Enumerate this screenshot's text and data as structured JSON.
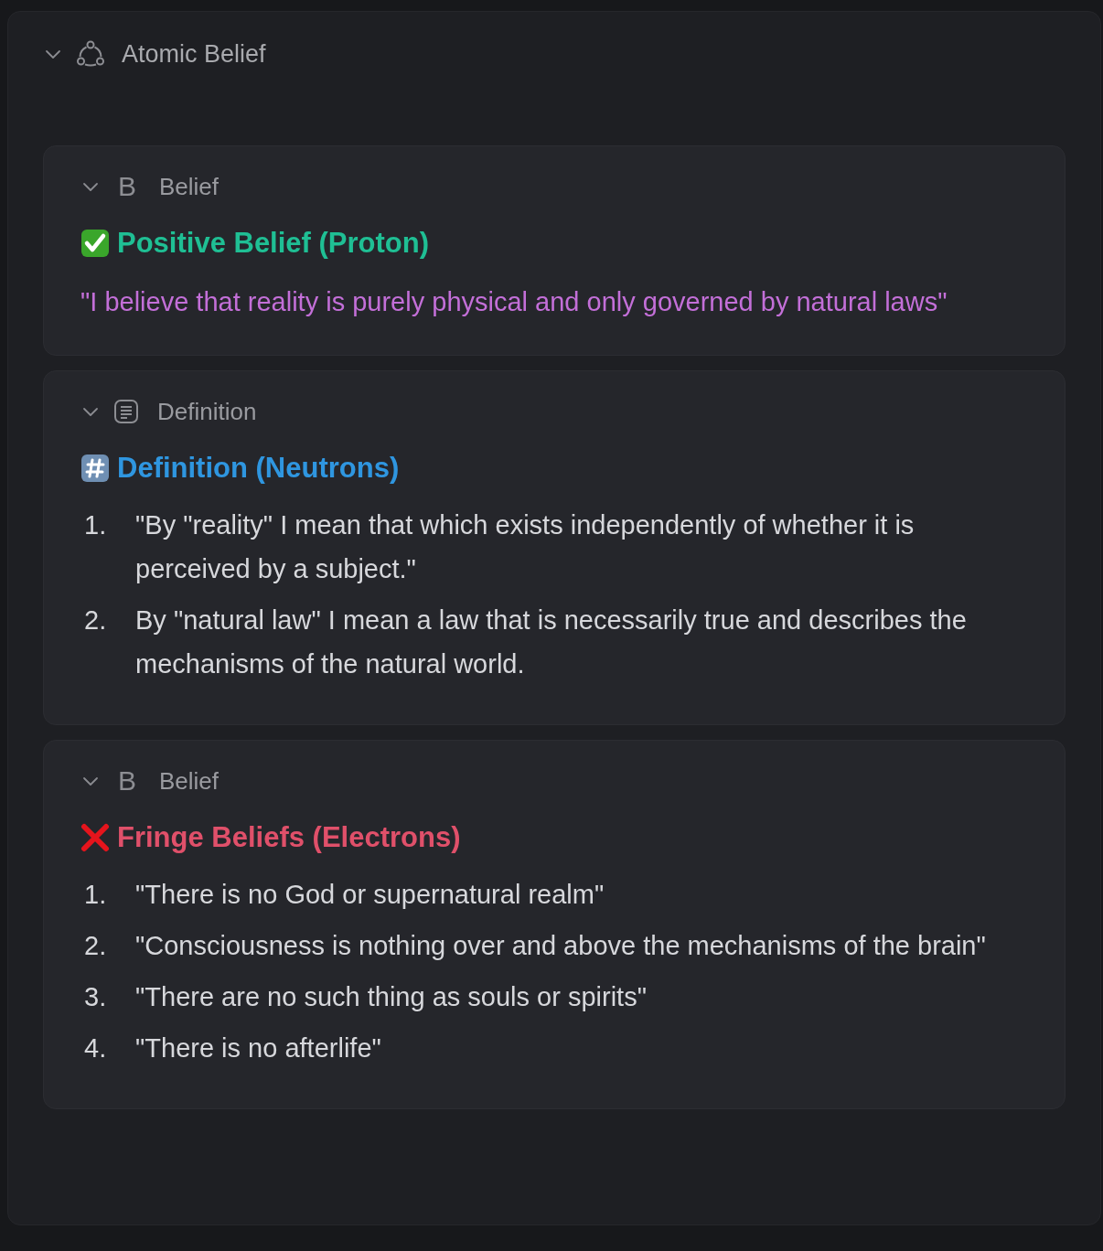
{
  "section": {
    "title": "Atomic Belief",
    "expanded": true
  },
  "cards": [
    {
      "kind": "belief",
      "badge": "B",
      "label": "Belief",
      "expanded": true,
      "heading": {
        "kind": "positive",
        "text": "Positive Belief (Proton)"
      },
      "quote": "\"I believe that reality is purely physical and only governed by natural laws\""
    },
    {
      "kind": "definition",
      "label": "Definition",
      "expanded": true,
      "heading": {
        "kind": "definition",
        "text": "Definition (Neutrons)"
      },
      "items": [
        {
          "number": "1.",
          "text": "\"By \"reality\" I mean that which exists independently of whether it is perceived by a subject.\""
        },
        {
          "number": "2.",
          "text": "By \"natural law\" I mean a law that is necessarily true and describes the mechanisms of the natural world."
        }
      ]
    },
    {
      "kind": "belief",
      "badge": "B",
      "label": "Belief",
      "expanded": true,
      "heading": {
        "kind": "negative",
        "text": "Fringe Beliefs (Electrons)"
      },
      "items": [
        {
          "number": "1.",
          "text": "\"There is no God or supernatural realm\""
        },
        {
          "number": "2.",
          "text": "\"Consciousness is nothing over and above the mechanisms of the brain\""
        },
        {
          "number": "3.",
          "text": "\"There are no such thing as souls or spirits\""
        },
        {
          "number": "4.",
          "text": "\"There is no afterlife\""
        }
      ]
    }
  ]
}
